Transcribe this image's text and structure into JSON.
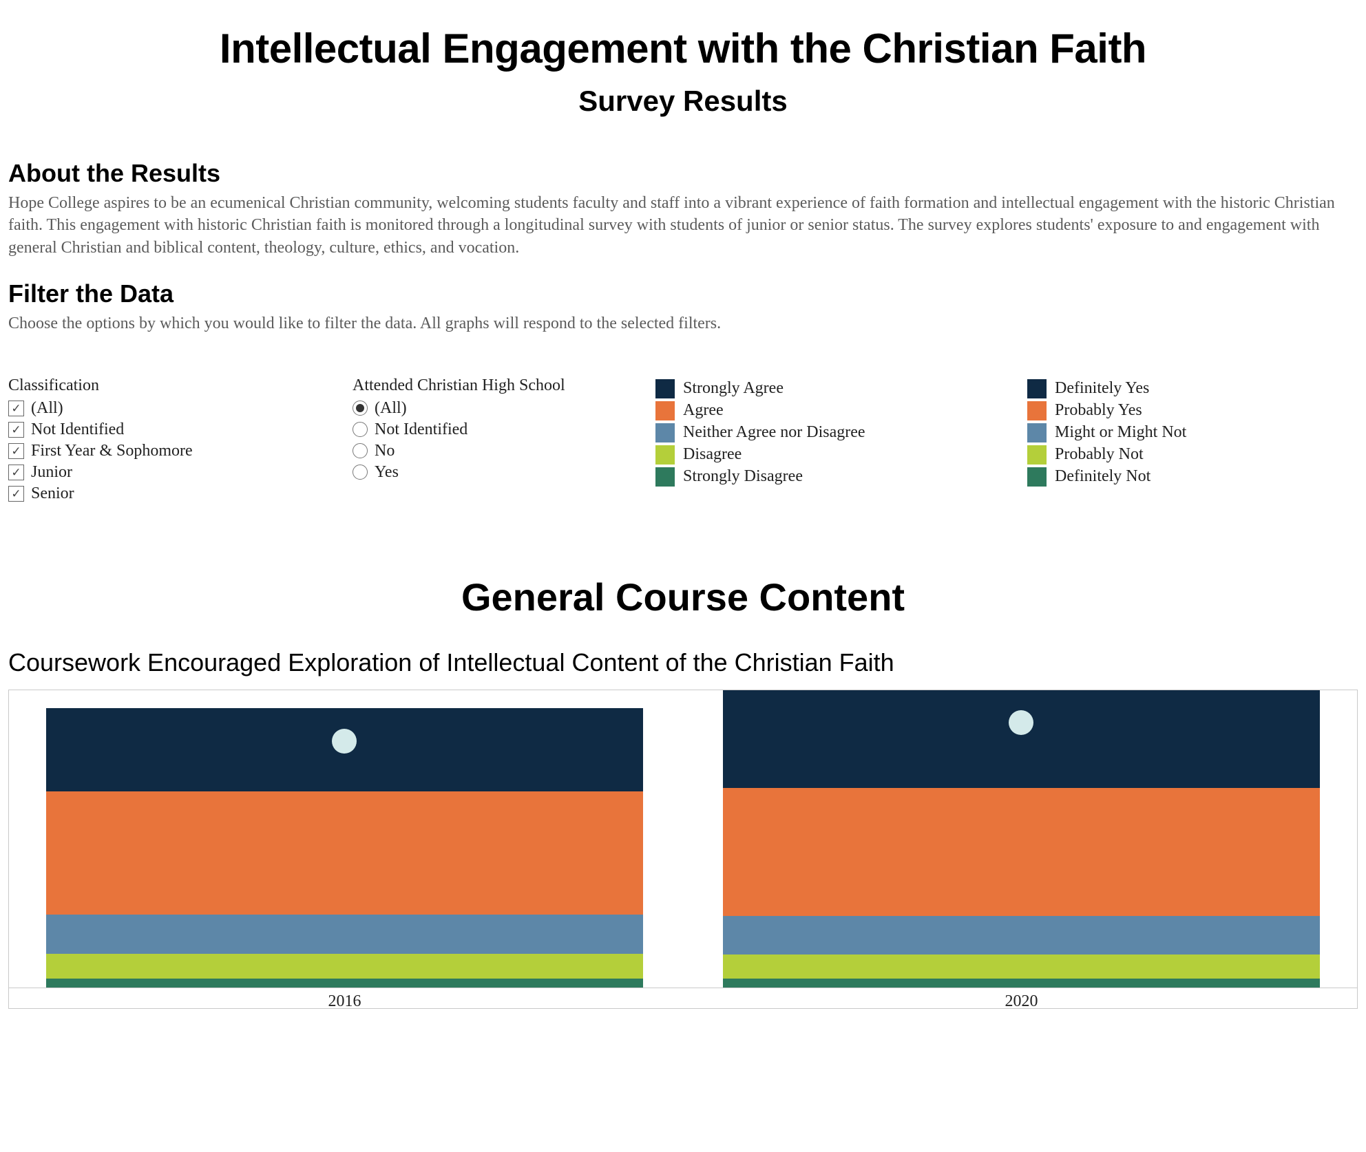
{
  "page": {
    "title": "Intellectual Engagement with the Christian Faith",
    "subtitle": "Survey Results"
  },
  "about": {
    "heading": "About the Results",
    "body": "Hope College aspires to be an ecumenical Christian community, welcoming students faculty and staff into a vibrant experience of faith formation and intellectual engagement with the historic Christian faith.  This engagement with historic Christian faith is monitored through a longitudinal survey with students of junior or senior status.  The survey explores students' exposure to and engagement with general Christian and biblical content, theology, culture, ethics, and vocation."
  },
  "filter": {
    "heading": "Filter the Data",
    "body": "Choose the options by which you would like to filter the data.  All graphs will respond to the selected filters.",
    "classification": {
      "label": "Classification",
      "options": [
        {
          "label": "(All)",
          "checked": true
        },
        {
          "label": "Not Identified",
          "checked": true
        },
        {
          "label": "First Year & Sophomore",
          "checked": true
        },
        {
          "label": "Junior",
          "checked": true
        },
        {
          "label": "Senior",
          "checked": true
        }
      ]
    },
    "highschool": {
      "label": "Attended Christian High School",
      "options": [
        {
          "label": "(All)",
          "selected": true
        },
        {
          "label": "Not Identified",
          "selected": false
        },
        {
          "label": "No",
          "selected": false
        },
        {
          "label": "Yes",
          "selected": false
        }
      ]
    }
  },
  "legends": {
    "agree_scale": [
      {
        "label": "Strongly Agree",
        "color": "#0f2a44"
      },
      {
        "label": "Agree",
        "color": "#e8743b"
      },
      {
        "label": "Neither Agree nor Disagree",
        "color": "#5d87a8"
      },
      {
        "label": "Disagree",
        "color": "#b4cf3a"
      },
      {
        "label": "Strongly Disagree",
        "color": "#2e7a5d"
      }
    ],
    "yes_scale": [
      {
        "label": "Definitely Yes",
        "color": "#0f2a44"
      },
      {
        "label": "Probably Yes",
        "color": "#e8743b"
      },
      {
        "label": "Might or Might Not",
        "color": "#5d87a8"
      },
      {
        "label": "Probably Not",
        "color": "#b4cf3a"
      },
      {
        "label": "Definitely Not",
        "color": "#2e7a5d"
      }
    ]
  },
  "section": {
    "title": "General Course Content"
  },
  "chart": {
    "title": "Coursework Encouraged Exploration of Intellectual Content of the Christian Faith",
    "x": {
      "0": "2016",
      "1": "2020"
    }
  },
  "chart_data": {
    "type": "bar",
    "title": "Coursework Encouraged Exploration of Intellectual Content of the Christian Faith",
    "categories": [
      "2016",
      "2020"
    ],
    "stack_order_bottom_to_top": [
      "Strongly Disagree",
      "Disagree",
      "Neither Agree nor Disagree",
      "Agree",
      "Strongly Agree"
    ],
    "series": [
      {
        "name": "Strongly Agree",
        "color": "#0f2a44",
        "values": [
          30,
          33
        ]
      },
      {
        "name": "Agree",
        "color": "#e8743b",
        "values": [
          44,
          43
        ]
      },
      {
        "name": "Neither Agree nor Disagree",
        "color": "#5d87a8",
        "values": [
          14,
          13
        ]
      },
      {
        "name": "Disagree",
        "color": "#b4cf3a",
        "values": [
          9,
          8
        ]
      },
      {
        "name": "Strongly Disagree",
        "color": "#2e7a5d",
        "values": [
          3,
          3
        ]
      }
    ],
    "ylim": [
      0,
      100
    ],
    "note": "Values estimated from stacked bar heights; segments sum to 100 per year.",
    "marker_overlay": {
      "description": "Pale circle centered horizontally in each bar near the upper region.",
      "color": "#d4eaea",
      "y_percent_from_top": [
        12,
        11
      ]
    },
    "bar_total_height_percent": [
      94,
      100
    ]
  }
}
